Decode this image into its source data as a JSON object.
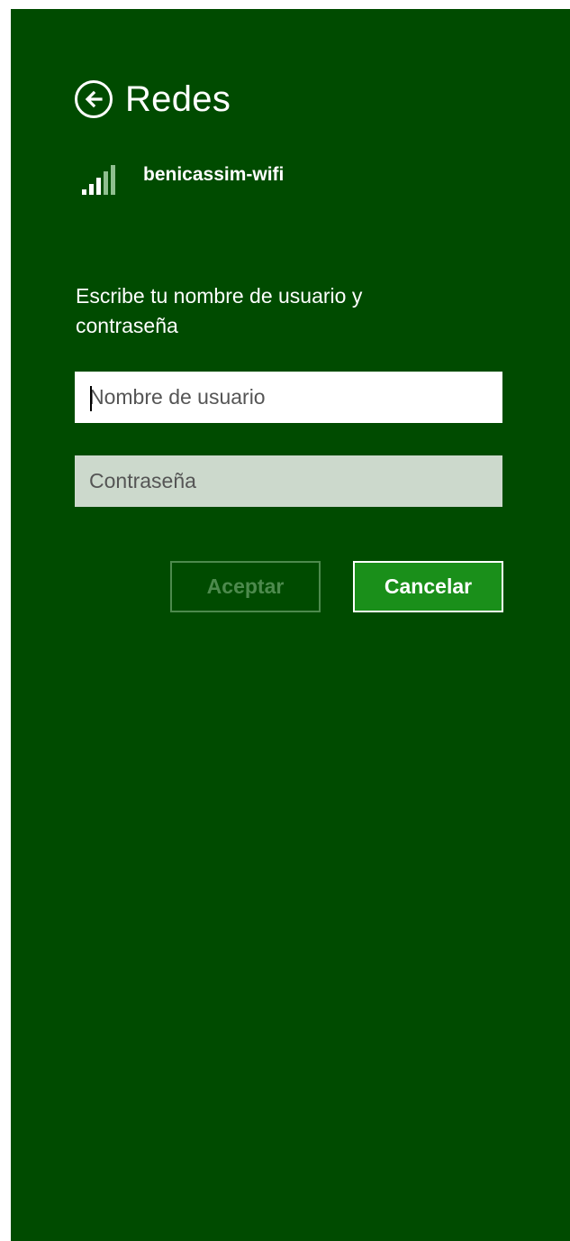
{
  "header": {
    "title": "Redes",
    "back_icon": "arrow-left-circle-icon"
  },
  "network": {
    "name": "benicassim-wifi",
    "signal_icon": "wifi-signal-icon",
    "signal_bars_total": 5,
    "signal_bars_strong": 3
  },
  "form": {
    "prompt": "Escribe tu nombre de usuario y contraseña",
    "username_placeholder": "Nombre de usuario",
    "password_placeholder": "Contraseña"
  },
  "buttons": {
    "accept_label": "Aceptar",
    "cancel_label": "Cancelar"
  },
  "colors": {
    "panel_background": "#004b00",
    "accent_button": "#1a8f1a",
    "disabled_button_text": "#4d8a4d",
    "password_field_background": "#ccd9cc"
  }
}
